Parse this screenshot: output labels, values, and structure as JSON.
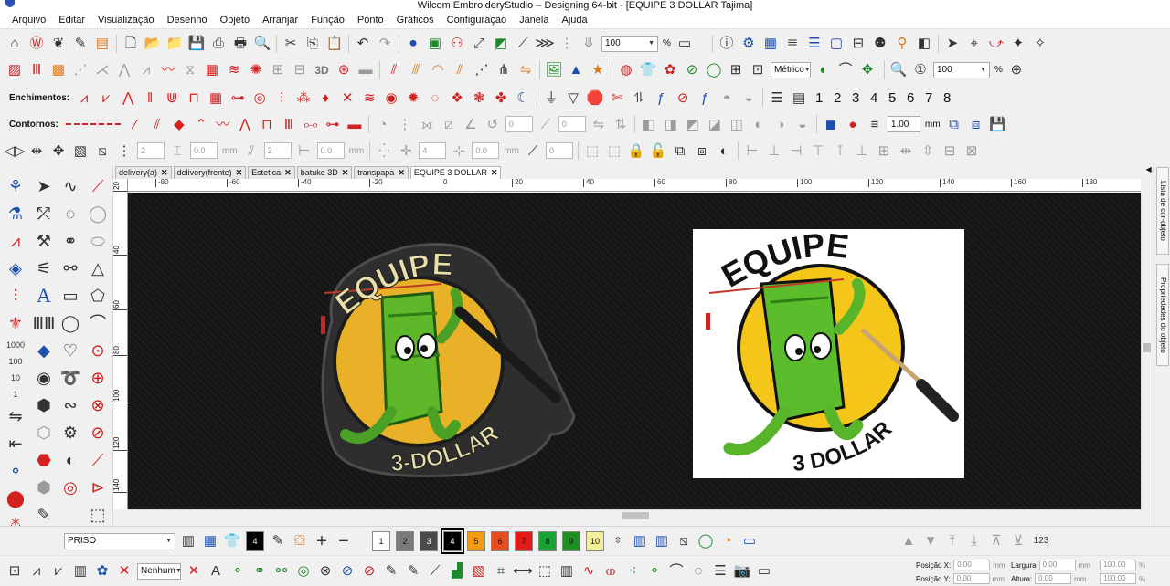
{
  "window": {
    "title": "Wilcom EmbroideryStudio – Designing 64-bit - [EQUIPE 3 DOLLAR       Tajima]"
  },
  "menu": [
    "Arquivo",
    "Editar",
    "Visualização",
    "Desenho",
    "Objeto",
    "Arranjar",
    "Função",
    "Ponto",
    "Gráficos",
    "Configuração",
    "Janela",
    "Ajuda"
  ],
  "toolbar1": {
    "zoom_value": "100",
    "zoom_unit": "%"
  },
  "toolbar2": {
    "unit_value": "Métrico",
    "zoom2_value": "100",
    "zoom2_unit": "%",
    "text_3d": "3D"
  },
  "toolbar3": {
    "label": "Enchimentos:",
    "numbers": [
      "1",
      "2",
      "3",
      "4",
      "5",
      "6",
      "7",
      "8"
    ]
  },
  "toolbar4": {
    "label": "Contornos:",
    "spin_a": "0",
    "spin_b": "0",
    "scale_value": "1.00",
    "scale_unit": "mm"
  },
  "toolbar5": {
    "spin_a": "2",
    "spin_b": "0.0",
    "unit_a": "mm",
    "spin_c": "2",
    "spin_d": "0.0",
    "unit_b": "mm",
    "spin_e": "4",
    "spin_f": "0.0",
    "unit_c": "mm",
    "spin_g": "0"
  },
  "left_tools": {
    "counter_1000": "1000",
    "counter_100": "100",
    "counter_10": "10",
    "counter_1": "1"
  },
  "tabs": [
    {
      "label": "delivery(a)"
    },
    {
      "label": "delivery(frente)"
    },
    {
      "label": "Estetica"
    },
    {
      "label": "batuke 3D"
    },
    {
      "label": "transpapa"
    },
    {
      "label": "EQUIPE 3 DOLLAR"
    }
  ],
  "ruler_h": [
    "-80",
    "-60",
    "-40",
    "-20",
    "0",
    "20",
    "40",
    "60",
    "80",
    "100",
    "120",
    "140",
    "160",
    "180"
  ],
  "ruler_v": [
    "20",
    "40",
    "60",
    "80",
    "100",
    "120",
    "140"
  ],
  "design": {
    "top_text": "EQUIPE",
    "bottom_text": "3-DOLLAR",
    "thread_colors": {
      "outline": "#2e2e2e",
      "yellow_text": "#e8e0a8",
      "circle": "#e9b128",
      "body": "#5fb82a"
    }
  },
  "reference_image": {
    "top_text": "EQUIPE",
    "bottom_text": "3 DOLLAR"
  },
  "right_dock": {
    "tab1": "Lista de cor-objeto",
    "tab2": "Propriedades do objeto"
  },
  "status": {
    "hoop_value": "PRISO",
    "color_numbers": [
      "1",
      "2",
      "3",
      "4",
      "5",
      "6",
      "7",
      "8",
      "9",
      "10"
    ],
    "color_swatches": [
      "#ffffff",
      "#7a7a7a",
      "#4a4a4a",
      "#000000",
      "#f39c12",
      "#e84a1c",
      "#e41a1a",
      "#16a335",
      "#1e8f1e",
      "#f4f09a"
    ],
    "counter_display": "4",
    "counter_123": "123",
    "fill_none": "Nenhum",
    "pos_x_label": "Posição X:",
    "pos_x_value": "0.00",
    "pos_x_unit": "mm",
    "pos_y_label": "Posição Y:",
    "pos_y_value": "0.00",
    "pos_y_unit": "mm",
    "width_label": "Largura",
    "width_value": "0.00",
    "width_unit": "mm",
    "height_label": "Altura:",
    "height_value": "0.00",
    "height_unit": "mm",
    "scale_x": "100.00",
    "scale_y": "100.00",
    "scale_unit": "%"
  }
}
